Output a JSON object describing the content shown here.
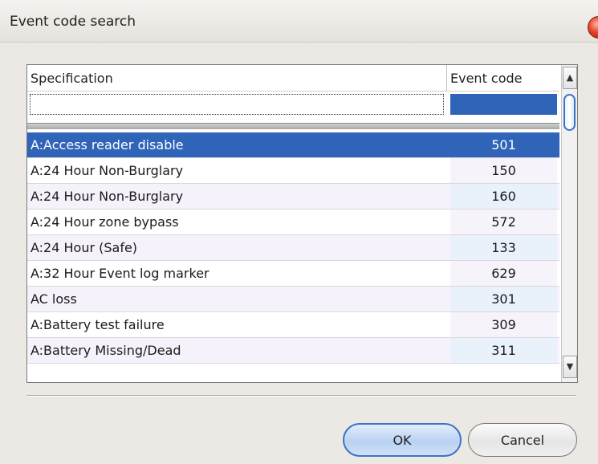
{
  "window": {
    "title": "Event code search"
  },
  "grid": {
    "columns": {
      "specification": "Specification",
      "event_code": "Event code"
    },
    "filter": {
      "specification_value": "",
      "event_code_value": ""
    },
    "selected_index": 0,
    "rows": [
      {
        "specification": "A:Access reader disable",
        "event_code": "501"
      },
      {
        "specification": "A:24 Hour Non-Burglary",
        "event_code": "150"
      },
      {
        "specification": "A:24 Hour Non-Burglary",
        "event_code": "160"
      },
      {
        "specification": "A:24 Hour zone bypass",
        "event_code": "572"
      },
      {
        "specification": "A:24 Hour (Safe)",
        "event_code": "133"
      },
      {
        "specification": "A:32 Hour Event log marker",
        "event_code": "629"
      },
      {
        "specification": "AC loss",
        "event_code": "301"
      },
      {
        "specification": "A:Battery test failure",
        "event_code": "309"
      },
      {
        "specification": "A:Battery Missing/Dead",
        "event_code": "311"
      }
    ]
  },
  "buttons": {
    "ok": "OK",
    "cancel": "Cancel"
  },
  "icons": {
    "close": "close-icon",
    "scroll_up": "scroll-up-arrow-icon",
    "scroll_down": "scroll-down-arrow-icon"
  },
  "colors": {
    "selection": "#2f64b8",
    "accent": "#3d72c4",
    "close": "#e0442a"
  }
}
